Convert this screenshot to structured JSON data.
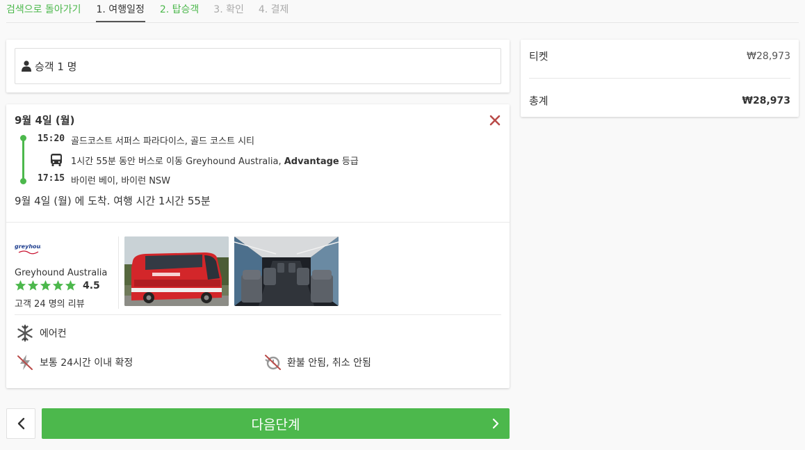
{
  "nav": {
    "back": "검색으로 돌아가기",
    "steps": [
      "1. 여행일정",
      "2. 탑승객",
      "3. 확인",
      "4. 결제"
    ]
  },
  "passenger": {
    "label": "승객 1 명"
  },
  "trip": {
    "date": "9월 4일 (월)",
    "depart_time": "15:20",
    "depart_place": "골드코스트 서퍼스 파라다이스, 골드 코스트 시티",
    "ride_prefix": "1시간 55분 동안 버스로 이동 Greyhound Australia, ",
    "ride_class": "Advantage",
    "ride_suffix": " 등급",
    "arrive_time": "17:15",
    "arrive_place": "바이런 베이, 바이런 NSW",
    "arrival_summary": "9월 4일 (월) 에 도착. 여행 시간 1시간 55분"
  },
  "operator": {
    "name": "Greyhound Australia",
    "logo_text": "greyhound",
    "rating": "4.5",
    "reviews": "고객 24 명의 리뷰",
    "stars": 5
  },
  "features": {
    "ac": "에어컨",
    "confirm": "보통 24시간 이내 확정",
    "refund": "환불 안됨, 취소 안됨"
  },
  "summary": {
    "ticket_label": "티켓",
    "ticket_value": "₩28,973",
    "total_label": "총계",
    "total_value": "₩28,973"
  },
  "buttons": {
    "next": "다음단계"
  },
  "colors": {
    "accent": "#4cb84c",
    "close": "#b94a48",
    "operator_red": "#c8102e"
  }
}
